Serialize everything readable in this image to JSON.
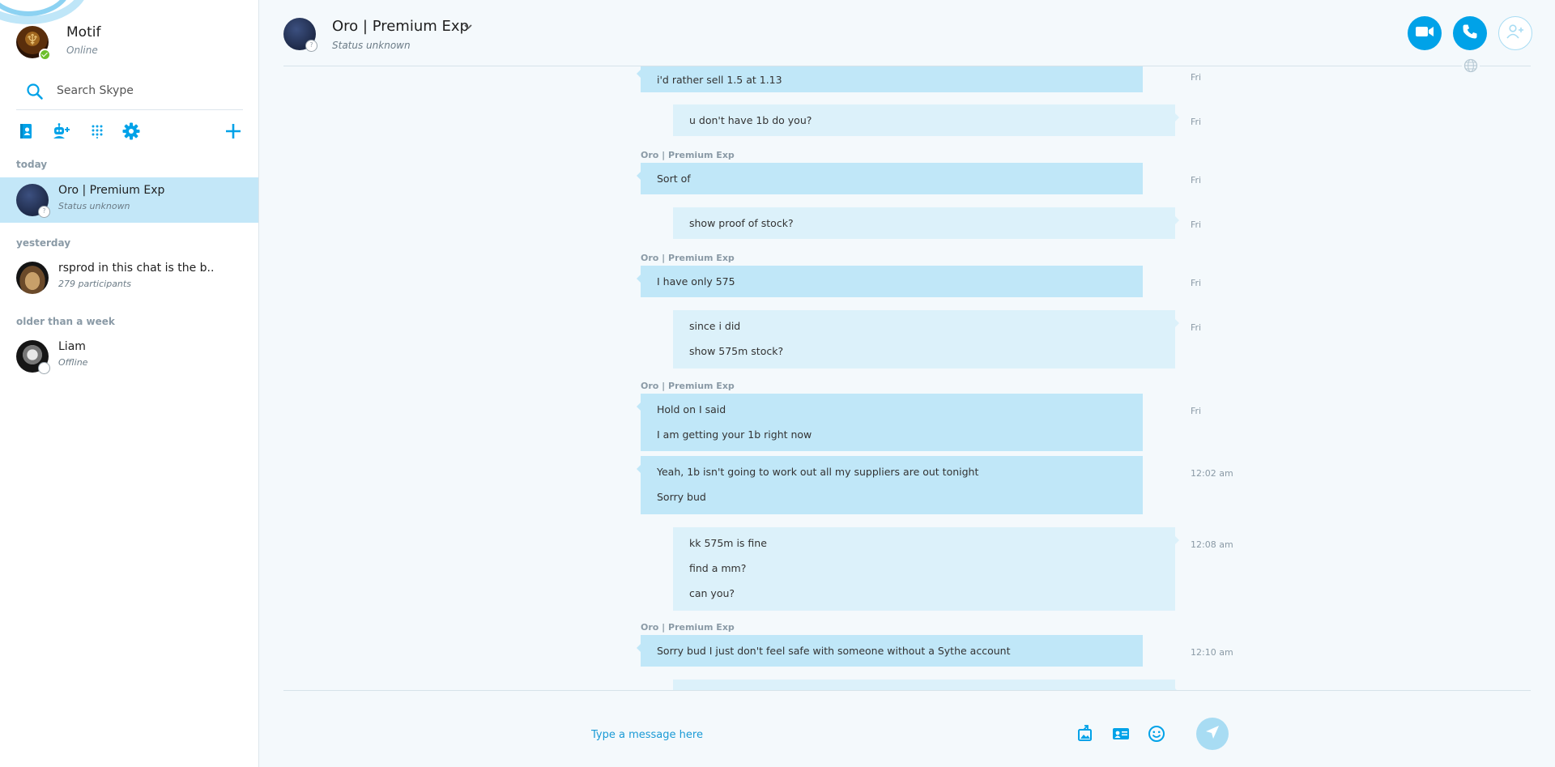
{
  "app": {
    "accent": "#00a2e8",
    "selected_bg": "#c3e7f8"
  },
  "profile": {
    "name": "Motif",
    "status": "Online"
  },
  "search": {
    "placeholder": "Search Skype"
  },
  "toolbar": {
    "icons": [
      "contacts-icon",
      "add-bot-icon",
      "dialpad-icon",
      "settings-icon",
      "new-chat-icon"
    ]
  },
  "sidebar": {
    "sections": [
      {
        "label": "today",
        "conversations": [
          {
            "name": "Oro | Premium Exp",
            "subtitle": "Status unknown",
            "selected": true
          }
        ]
      },
      {
        "label": "yesterday",
        "conversations": [
          {
            "name": "rsprod in this chat is the b..",
            "subtitle": "279 participants",
            "selected": false
          }
        ]
      },
      {
        "label": "older than a week",
        "conversations": [
          {
            "name": "Liam",
            "subtitle": "Offline",
            "selected": false
          }
        ]
      }
    ]
  },
  "chat": {
    "contact_name": "Oro | Premium Exp",
    "contact_status": "Status unknown",
    "messages": [
      {
        "direction": "in",
        "lines": [
          "i'd rather sell 1.5 at 1.13"
        ],
        "time": "Fri"
      },
      {
        "direction": "out",
        "lines": [
          "u don't have 1b do you?"
        ],
        "time": "Fri"
      },
      {
        "direction": "in",
        "sender": "Oro | Premium Exp",
        "lines": [
          "Sort of"
        ],
        "time": "Fri"
      },
      {
        "direction": "out",
        "lines": [
          "show proof of stock?"
        ],
        "time": "Fri"
      },
      {
        "direction": "in",
        "sender": "Oro | Premium Exp",
        "lines": [
          "I have only 575"
        ],
        "time": "Fri"
      },
      {
        "direction": "out",
        "lines": [
          "since i did",
          "show 575m stock?"
        ],
        "time": "Fri"
      },
      {
        "direction": "in",
        "sender": "Oro | Premium Exp",
        "lines": [
          "Hold on I said",
          "I am getting your 1b right now"
        ],
        "time": "Fri"
      },
      {
        "direction": "in",
        "lines": [
          "Yeah, 1b isn't going to work out all my suppliers are out tonight",
          "Sorry bud"
        ],
        "time": "12:02 am"
      },
      {
        "direction": "out",
        "lines": [
          "kk 575m is fine",
          "find a mm?",
          "can you?"
        ],
        "time": "12:08 am"
      },
      {
        "direction": "in",
        "sender": "Oro | Premium Exp",
        "lines": [
          "Sorry bud I just don't feel safe with someone without a Sythe account"
        ],
        "time": "12:10 am"
      }
    ]
  },
  "composer": {
    "placeholder": "Type a message here"
  }
}
